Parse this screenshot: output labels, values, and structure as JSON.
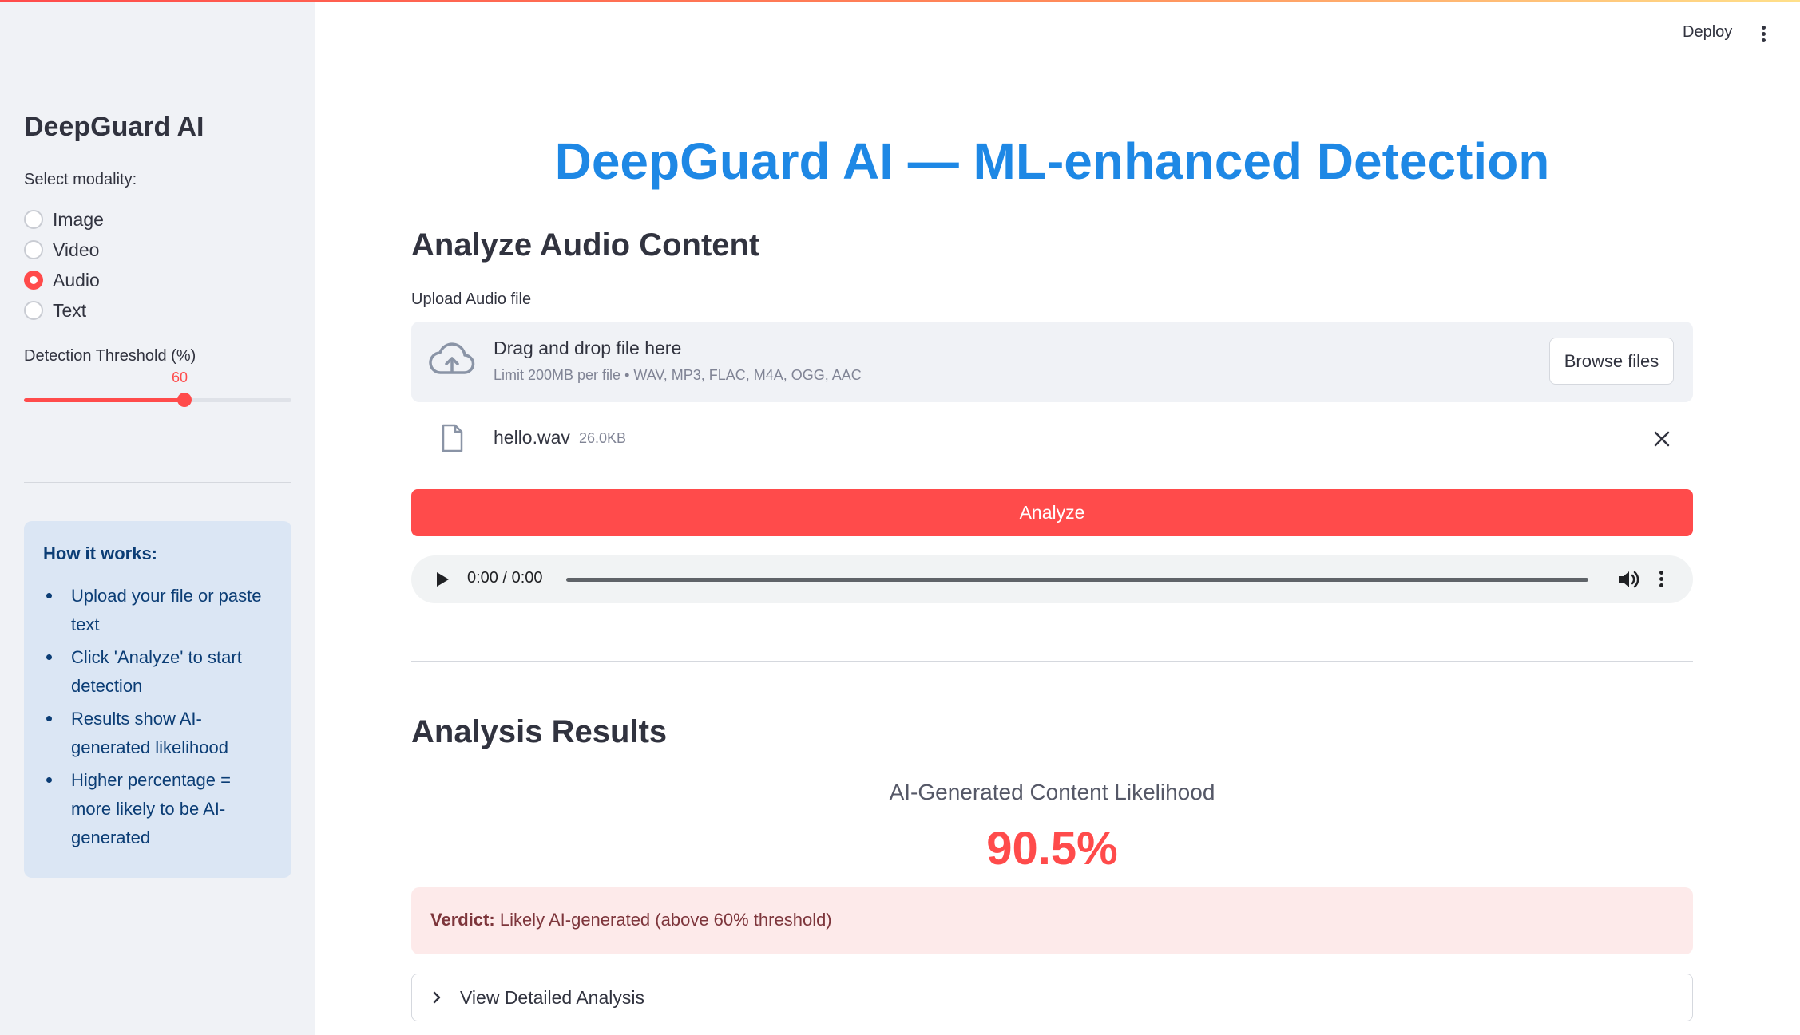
{
  "app": {
    "deploy_label": "Deploy",
    "accent_color": "#ff4b4b",
    "title_color": "#1e88e5"
  },
  "sidebar": {
    "title": "DeepGuard AI",
    "modality_label": "Select modality:",
    "modalities": [
      {
        "label": "Image",
        "checked": false
      },
      {
        "label": "Video",
        "checked": false
      },
      {
        "label": "Audio",
        "checked": true
      },
      {
        "label": "Text",
        "checked": false
      }
    ],
    "threshold": {
      "label": "Detection Threshold (%)",
      "value": "60",
      "min": 0,
      "max": 100
    },
    "info": {
      "title": "How it works:",
      "items": [
        "Upload your file or paste text",
        "Click 'Analyze' to start detection",
        "Results show AI-generated likelihood",
        "Higher percentage = more likely to be AI-generated"
      ]
    }
  },
  "main": {
    "title": "DeepGuard AI — ML-enhanced Detection",
    "section_heading": "Analyze Audio Content",
    "upload": {
      "label": "Upload Audio file",
      "drop_text": "Drag and drop file here",
      "limit_text": "Limit 200MB per file • WAV, MP3, FLAC, M4A, OGG, AAC",
      "browse_label": "Browse files"
    },
    "file": {
      "name": "hello.wav",
      "size": "26.0KB"
    },
    "analyze_label": "Analyze",
    "audio_player": {
      "time": "0:00 / 0:00"
    },
    "results": {
      "heading": "Analysis Results",
      "metric_label": "AI-Generated Content Likelihood",
      "metric_value": "90.5%",
      "verdict_prefix": "Verdict:",
      "verdict_text": "Likely AI-generated (above 60% threshold)",
      "expander_label": "View Detailed Analysis"
    }
  }
}
